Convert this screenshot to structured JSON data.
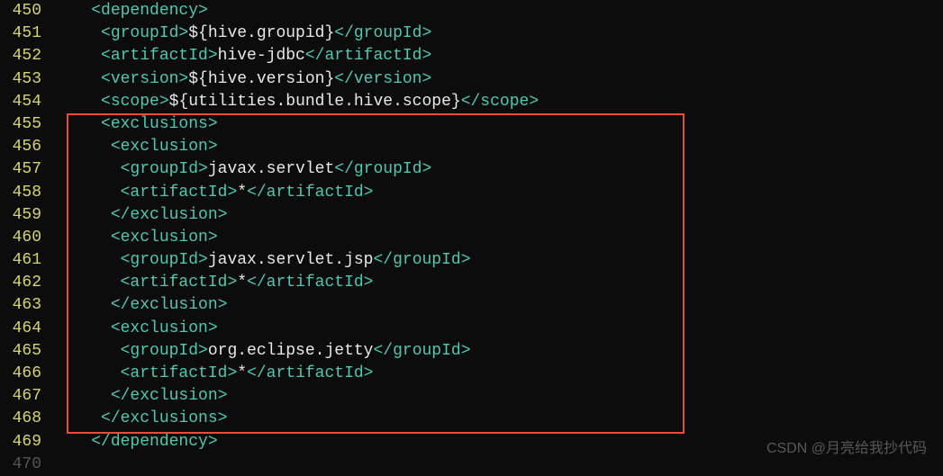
{
  "watermark": "CSDN @月亮给我抄代码",
  "lineNumbers": [
    "450",
    "451",
    "452",
    "453",
    "454",
    "455",
    "456",
    "457",
    "458",
    "459",
    "460",
    "461",
    "462",
    "463",
    "464",
    "465",
    "466",
    "467",
    "468",
    "469",
    "470"
  ],
  "code": {
    "indent": {
      "i4": "    ",
      "i5": "     ",
      "i6": "      ",
      "i7": "       ",
      "i8": "        "
    },
    "tags": {
      "dependencyOpen": "<dependency>",
      "dependencyClose": "</dependency>",
      "groupIdOpen": "<groupId>",
      "groupIdClose": "</groupId>",
      "artifactIdOpen": "<artifactId>",
      "artifactIdClose": "</artifactId>",
      "versionOpen": "<version>",
      "versionClose": "</version>",
      "scopeOpen": "<scope>",
      "scopeClose": "</scope>",
      "exclusionsOpen": "<exclusions>",
      "exclusionsClose": "</exclusions>",
      "exclusionOpen": "<exclusion>",
      "exclusionClose": "</exclusion>"
    },
    "values": {
      "hiveGroupId": "${hive.groupid}",
      "hiveJdbc": "hive-jdbc",
      "hiveVersion": "${hive.version}",
      "scope": "${utilities.bundle.hive.scope}",
      "javaxServlet": "javax.servlet",
      "javaxServletJsp": "javax.servlet.jsp",
      "jetty": "org.eclipse.jetty",
      "star": "*"
    }
  }
}
